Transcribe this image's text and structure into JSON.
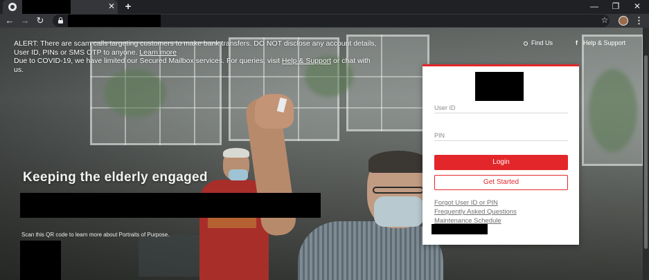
{
  "browser": {
    "tab": {
      "close_icon": "close-icon",
      "favicon": "globe-icon"
    },
    "new_tab_icon": "plus-icon",
    "window_controls": {
      "minimize": "—",
      "restore": "❐",
      "close": "✕"
    },
    "nav": {
      "back": "←",
      "forward": "→",
      "reload": "↻"
    },
    "bookmark_icon": "star-icon",
    "menu_icon": "more-vert-icon"
  },
  "alert": {
    "line1": "ALERT: There are scam calls targeting customers to make bank transfers. DO NOT disclose any account details, User ID, PINs or SMS OTP to anyone.",
    "learn_more": "Learn more",
    "line2": "Due to COVID-19, we have limited our Secured Mailbox services. For queries, visit",
    "help_link": "Help & Support",
    "line2_tail": "or chat with us."
  },
  "utility_links": {
    "find_us": "Find Us",
    "help_support": "Help & Support"
  },
  "hero": {
    "headline": "Keeping the elderly engaged",
    "qr_caption": "Scan this QR code to learn more about Portraits of Purpose."
  },
  "login": {
    "user_id_placeholder": "User ID",
    "pin_placeholder": "PIN",
    "login_label": "Login",
    "get_started_label": "Get Started",
    "links": [
      "Forgot User ID or PIN",
      "Frequently Asked Questions",
      "Maintenance Schedule"
    ]
  },
  "colors": {
    "brand_red": "#e3262a",
    "chrome_dark": "#202124",
    "chrome_mid": "#35363a"
  }
}
